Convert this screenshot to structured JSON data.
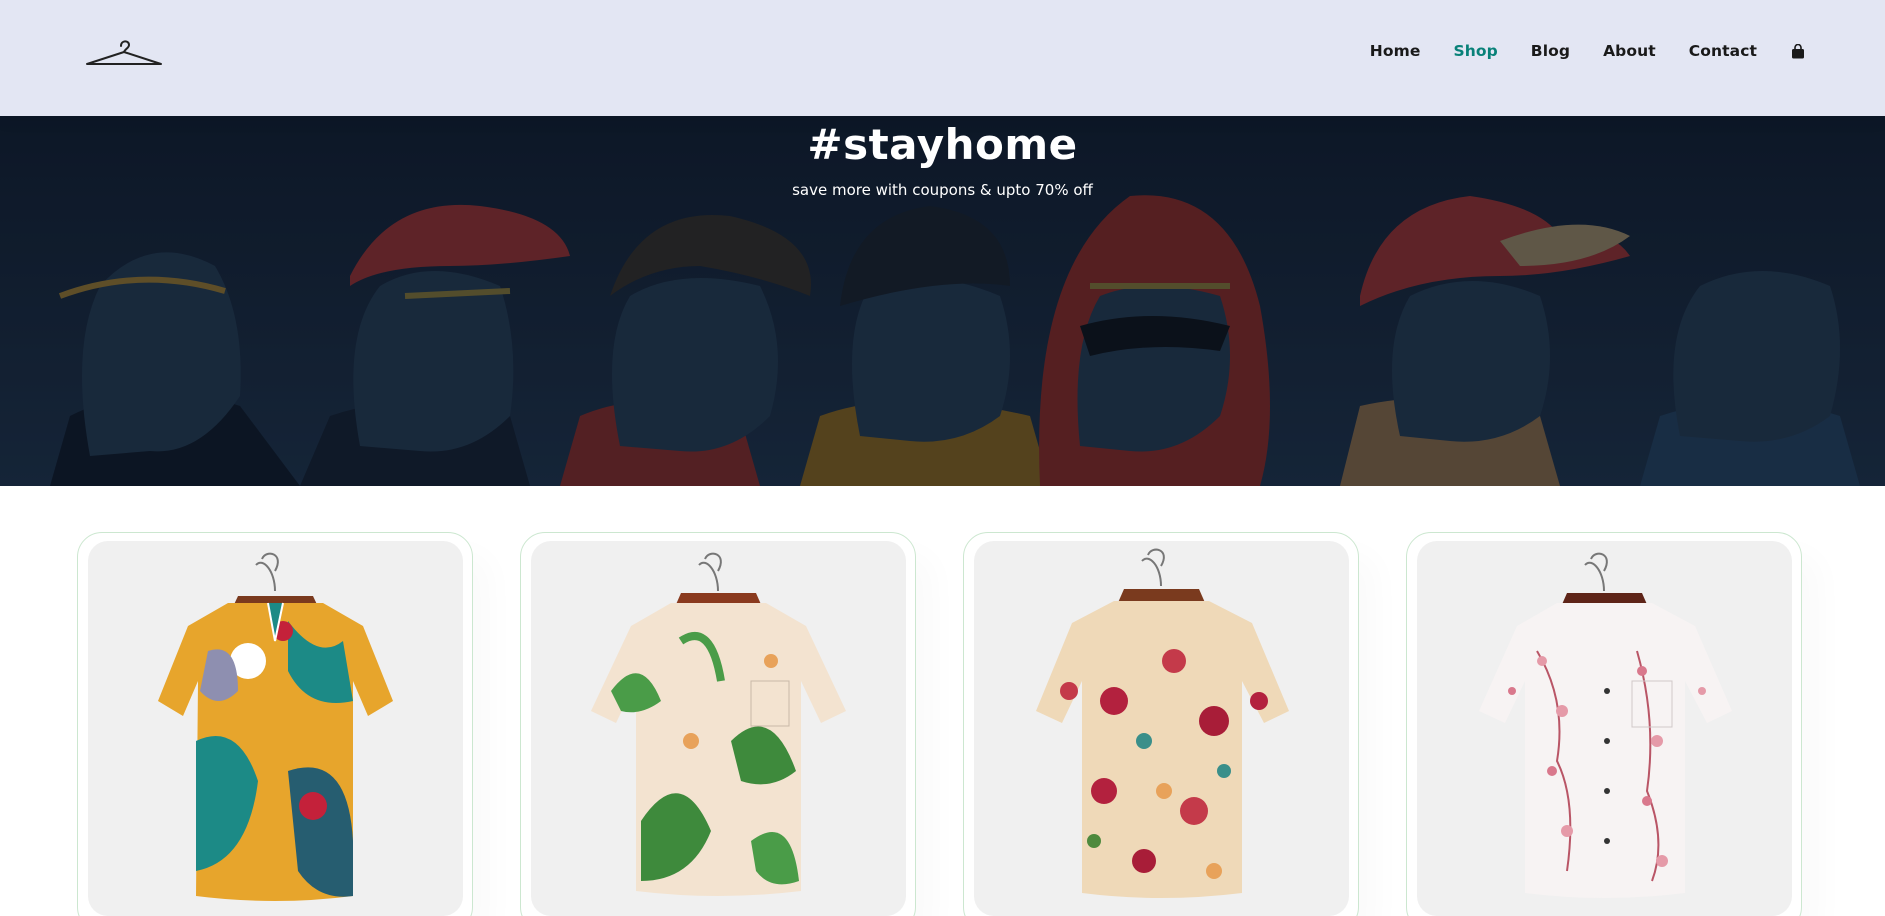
{
  "header": {
    "logo_icon": "hanger-icon",
    "nav": [
      {
        "label": "Home",
        "active": false
      },
      {
        "label": "Shop",
        "active": true
      },
      {
        "label": "Blog",
        "active": false
      },
      {
        "label": "About",
        "active": false
      },
      {
        "label": "Contact",
        "active": false
      }
    ],
    "cart_icon": "shopping-bag-icon",
    "active_color": "#088178"
  },
  "hero": {
    "title": "#stayhome",
    "subtitle": "save more with coupons & upto 70% off"
  },
  "products": [
    {
      "image": "multicolor abstract print short-sleeve shirt"
    },
    {
      "image": "cream shirt with green leaf and lily print"
    },
    {
      "image": "beige shirt with red floral print"
    },
    {
      "image": "white shirt with pink blossom print"
    }
  ],
  "colors": {
    "header_bg": "#e3e6f3",
    "accent": "#088178",
    "card_border": "#cce7d0"
  }
}
